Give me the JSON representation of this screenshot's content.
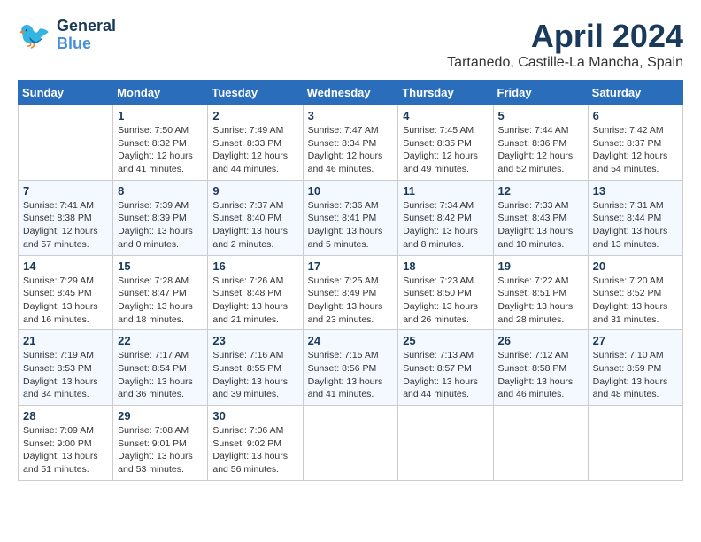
{
  "header": {
    "logo_general": "General",
    "logo_blue": "Blue",
    "month_year": "April 2024",
    "location": "Tartanedo, Castille-La Mancha, Spain"
  },
  "days_of_week": [
    "Sunday",
    "Monday",
    "Tuesday",
    "Wednesday",
    "Thursday",
    "Friday",
    "Saturday"
  ],
  "weeks": [
    {
      "days": [
        {
          "number": "",
          "sunrise": "",
          "sunset": "",
          "daylight": ""
        },
        {
          "number": "1",
          "sunrise": "Sunrise: 7:50 AM",
          "sunset": "Sunset: 8:32 PM",
          "daylight": "Daylight: 12 hours and 41 minutes."
        },
        {
          "number": "2",
          "sunrise": "Sunrise: 7:49 AM",
          "sunset": "Sunset: 8:33 PM",
          "daylight": "Daylight: 12 hours and 44 minutes."
        },
        {
          "number": "3",
          "sunrise": "Sunrise: 7:47 AM",
          "sunset": "Sunset: 8:34 PM",
          "daylight": "Daylight: 12 hours and 46 minutes."
        },
        {
          "number": "4",
          "sunrise": "Sunrise: 7:45 AM",
          "sunset": "Sunset: 8:35 PM",
          "daylight": "Daylight: 12 hours and 49 minutes."
        },
        {
          "number": "5",
          "sunrise": "Sunrise: 7:44 AM",
          "sunset": "Sunset: 8:36 PM",
          "daylight": "Daylight: 12 hours and 52 minutes."
        },
        {
          "number": "6",
          "sunrise": "Sunrise: 7:42 AM",
          "sunset": "Sunset: 8:37 PM",
          "daylight": "Daylight: 12 hours and 54 minutes."
        }
      ]
    },
    {
      "days": [
        {
          "number": "7",
          "sunrise": "Sunrise: 7:41 AM",
          "sunset": "Sunset: 8:38 PM",
          "daylight": "Daylight: 12 hours and 57 minutes."
        },
        {
          "number": "8",
          "sunrise": "Sunrise: 7:39 AM",
          "sunset": "Sunset: 8:39 PM",
          "daylight": "Daylight: 13 hours and 0 minutes."
        },
        {
          "number": "9",
          "sunrise": "Sunrise: 7:37 AM",
          "sunset": "Sunset: 8:40 PM",
          "daylight": "Daylight: 13 hours and 2 minutes."
        },
        {
          "number": "10",
          "sunrise": "Sunrise: 7:36 AM",
          "sunset": "Sunset: 8:41 PM",
          "daylight": "Daylight: 13 hours and 5 minutes."
        },
        {
          "number": "11",
          "sunrise": "Sunrise: 7:34 AM",
          "sunset": "Sunset: 8:42 PM",
          "daylight": "Daylight: 13 hours and 8 minutes."
        },
        {
          "number": "12",
          "sunrise": "Sunrise: 7:33 AM",
          "sunset": "Sunset: 8:43 PM",
          "daylight": "Daylight: 13 hours and 10 minutes."
        },
        {
          "number": "13",
          "sunrise": "Sunrise: 7:31 AM",
          "sunset": "Sunset: 8:44 PM",
          "daylight": "Daylight: 13 hours and 13 minutes."
        }
      ]
    },
    {
      "days": [
        {
          "number": "14",
          "sunrise": "Sunrise: 7:29 AM",
          "sunset": "Sunset: 8:45 PM",
          "daylight": "Daylight: 13 hours and 16 minutes."
        },
        {
          "number": "15",
          "sunrise": "Sunrise: 7:28 AM",
          "sunset": "Sunset: 8:47 PM",
          "daylight": "Daylight: 13 hours and 18 minutes."
        },
        {
          "number": "16",
          "sunrise": "Sunrise: 7:26 AM",
          "sunset": "Sunset: 8:48 PM",
          "daylight": "Daylight: 13 hours and 21 minutes."
        },
        {
          "number": "17",
          "sunrise": "Sunrise: 7:25 AM",
          "sunset": "Sunset: 8:49 PM",
          "daylight": "Daylight: 13 hours and 23 minutes."
        },
        {
          "number": "18",
          "sunrise": "Sunrise: 7:23 AM",
          "sunset": "Sunset: 8:50 PM",
          "daylight": "Daylight: 13 hours and 26 minutes."
        },
        {
          "number": "19",
          "sunrise": "Sunrise: 7:22 AM",
          "sunset": "Sunset: 8:51 PM",
          "daylight": "Daylight: 13 hours and 28 minutes."
        },
        {
          "number": "20",
          "sunrise": "Sunrise: 7:20 AM",
          "sunset": "Sunset: 8:52 PM",
          "daylight": "Daylight: 13 hours and 31 minutes."
        }
      ]
    },
    {
      "days": [
        {
          "number": "21",
          "sunrise": "Sunrise: 7:19 AM",
          "sunset": "Sunset: 8:53 PM",
          "daylight": "Daylight: 13 hours and 34 minutes."
        },
        {
          "number": "22",
          "sunrise": "Sunrise: 7:17 AM",
          "sunset": "Sunset: 8:54 PM",
          "daylight": "Daylight: 13 hours and 36 minutes."
        },
        {
          "number": "23",
          "sunrise": "Sunrise: 7:16 AM",
          "sunset": "Sunset: 8:55 PM",
          "daylight": "Daylight: 13 hours and 39 minutes."
        },
        {
          "number": "24",
          "sunrise": "Sunrise: 7:15 AM",
          "sunset": "Sunset: 8:56 PM",
          "daylight": "Daylight: 13 hours and 41 minutes."
        },
        {
          "number": "25",
          "sunrise": "Sunrise: 7:13 AM",
          "sunset": "Sunset: 8:57 PM",
          "daylight": "Daylight: 13 hours and 44 minutes."
        },
        {
          "number": "26",
          "sunrise": "Sunrise: 7:12 AM",
          "sunset": "Sunset: 8:58 PM",
          "daylight": "Daylight: 13 hours and 46 minutes."
        },
        {
          "number": "27",
          "sunrise": "Sunrise: 7:10 AM",
          "sunset": "Sunset: 8:59 PM",
          "daylight": "Daylight: 13 hours and 48 minutes."
        }
      ]
    },
    {
      "days": [
        {
          "number": "28",
          "sunrise": "Sunrise: 7:09 AM",
          "sunset": "Sunset: 9:00 PM",
          "daylight": "Daylight: 13 hours and 51 minutes."
        },
        {
          "number": "29",
          "sunrise": "Sunrise: 7:08 AM",
          "sunset": "Sunset: 9:01 PM",
          "daylight": "Daylight: 13 hours and 53 minutes."
        },
        {
          "number": "30",
          "sunrise": "Sunrise: 7:06 AM",
          "sunset": "Sunset: 9:02 PM",
          "daylight": "Daylight: 13 hours and 56 minutes."
        },
        {
          "number": "",
          "sunrise": "",
          "sunset": "",
          "daylight": ""
        },
        {
          "number": "",
          "sunrise": "",
          "sunset": "",
          "daylight": ""
        },
        {
          "number": "",
          "sunrise": "",
          "sunset": "",
          "daylight": ""
        },
        {
          "number": "",
          "sunrise": "",
          "sunset": "",
          "daylight": ""
        }
      ]
    }
  ]
}
